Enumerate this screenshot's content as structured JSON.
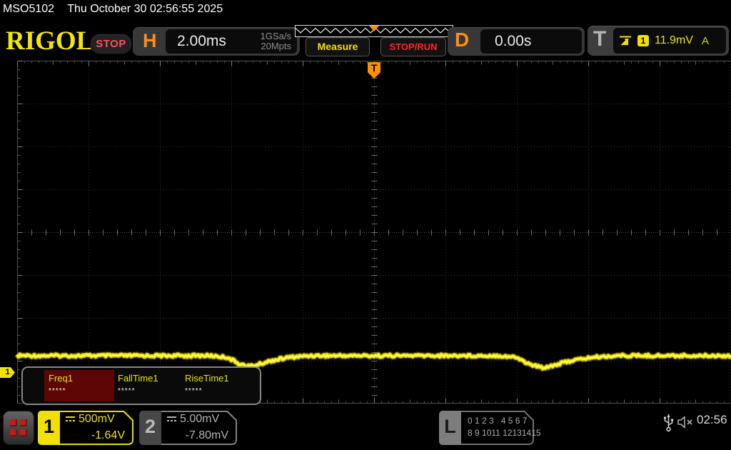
{
  "titlebar": {
    "model": "MSO5102",
    "datetime": "Thu October 30 02:56:55 2025"
  },
  "header": {
    "logo": "RIGOL",
    "run_state": "STOP",
    "horizontal": {
      "label": "H",
      "timebase": "2.00ms",
      "sample_rate": "1GSa/s",
      "mem_depth": "20Mpts"
    },
    "measure_button": "Measure",
    "stoprun_button": "STOP/RUN",
    "delay": {
      "label": "D",
      "value": "0.00s"
    },
    "trigger": {
      "label": "T",
      "source_channel": "1",
      "level": "11.9mV",
      "mode": "A"
    }
  },
  "icons": {
    "trigger_slope": "rising-slope-icon",
    "memory_position": "orange-triangle-marker",
    "layout_button": "four-red-squares",
    "usb": "usb-device-icon",
    "sound": "speaker-muted-icon",
    "coupling_ch1": "dc-coupling-icon",
    "coupling_ch2": "dc-coupling-icon"
  },
  "graticule": {
    "trigger_marker_label": "T",
    "ch1_marker": "1"
  },
  "measurements": {
    "items": [
      {
        "label": "Freq1",
        "value": "*****",
        "selected": true
      },
      {
        "label": "FallTime1",
        "value": "*****",
        "selected": false
      },
      {
        "label": "RiseTime1",
        "value": "*****",
        "selected": false
      }
    ]
  },
  "channels": {
    "ch1": {
      "number": "1",
      "scale": "500mV",
      "offset": "-1.64V",
      "color": "#f0e003"
    },
    "ch2": {
      "number": "2",
      "scale": "5.00mV",
      "offset": "-7.80mV",
      "color": "#b5b5b5"
    }
  },
  "digital": {
    "label": "L",
    "row1": "0 1 2 3   4 5 6 7",
    "row2": "8 9 1011 12131415"
  },
  "status": {
    "clock": "02:56"
  },
  "chart_data": {
    "type": "line",
    "title": "CH1 oscilloscope trace",
    "x_units": "ms",
    "y_units": "V",
    "timebase_per_div": "2.00ms",
    "volts_per_div": "500mV",
    "ch1_offset": "-1.64V",
    "x_range": [
      -10,
      10
    ],
    "divisions": {
      "horizontal": 10,
      "vertical": 8
    },
    "baseline_above_ground_v": 0.2,
    "noise_vpp_v": 0.06,
    "points_t_ms_v": [
      [
        -10,
        0.2
      ],
      [
        -4.6,
        0.2
      ],
      [
        -4.1,
        0.18
      ],
      [
        -3.8,
        0.11
      ],
      [
        -3.55,
        0.075
      ],
      [
        -3.3,
        0.09
      ],
      [
        -2.9,
        0.14
      ],
      [
        -2.4,
        0.18
      ],
      [
        -1.8,
        0.2
      ],
      [
        0,
        0.2
      ],
      [
        3.5,
        0.2
      ],
      [
        4.0,
        0.18
      ],
      [
        4.35,
        0.1
      ],
      [
        4.72,
        0.06
      ],
      [
        5.05,
        0.09
      ],
      [
        5.5,
        0.14
      ],
      [
        6.1,
        0.18
      ],
      [
        6.8,
        0.2
      ],
      [
        10,
        0.2
      ]
    ]
  }
}
